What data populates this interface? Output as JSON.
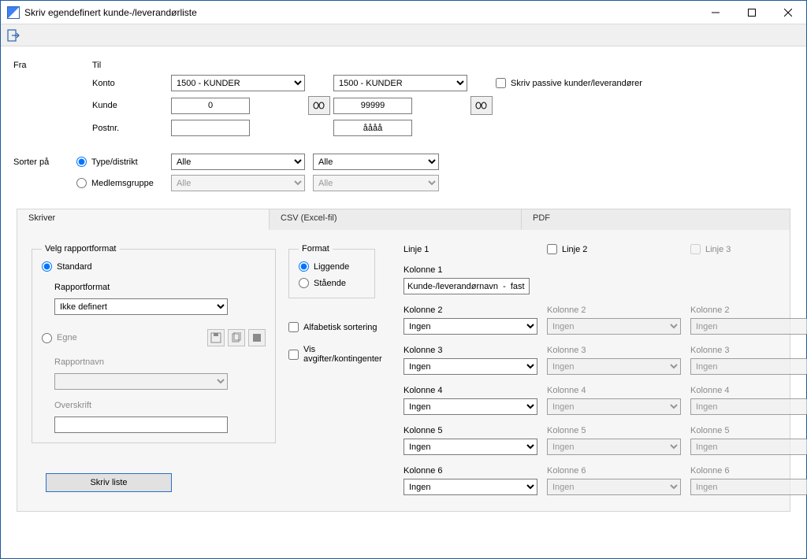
{
  "window": {
    "title": "Skriv egendefinert kunde-/leverandørliste"
  },
  "filter": {
    "fra_label": "Fra",
    "til_label": "Til",
    "konto_label": "Konto",
    "kunde_label": "Kunde",
    "postnr_label": "Postnr.",
    "konto_fra": "1500 - KUNDER",
    "konto_til": "1500 - KUNDER",
    "kunde_fra": "0",
    "kunde_til": "99999",
    "postnr_fra": "",
    "postnr_til": "åååå",
    "passiv_chk": "Skriv passive kunder/leverandører"
  },
  "sort": {
    "label": "Sorter på",
    "type_label": "Type/distrikt",
    "medlem_label": "Medlemsgruppe",
    "alle": "Alle"
  },
  "tabs": {
    "t1": "Skriver",
    "t2": "CSV  (Excel-fil)",
    "t3": "PDF"
  },
  "report": {
    "group_label": "Velg rapportformat",
    "standard": "Standard",
    "rapportformat_label": "Rapportformat",
    "rapportformat_value": "Ikke definert",
    "egne": "Egne",
    "rapportnavn_label": "Rapportnavn",
    "overskrift_label": "Overskrift"
  },
  "format": {
    "group_label": "Format",
    "liggende": "Liggende",
    "staende": "Stående",
    "alfabetisk": "Alfabetisk sortering",
    "avgifter": "Vis avgifter/kontingenter"
  },
  "linje": {
    "l1": "Linje 1",
    "l2": "Linje 2",
    "l3": "Linje 3",
    "kol": [
      "Kolonne 1",
      "Kolonne 2",
      "Kolonne 3",
      "Kolonne 4",
      "Kolonne 5",
      "Kolonne 6"
    ],
    "kol1_value": "Kunde-/leverandørnavn  -  fast",
    "ingen": "Ingen"
  },
  "print_btn": "Skriv liste"
}
